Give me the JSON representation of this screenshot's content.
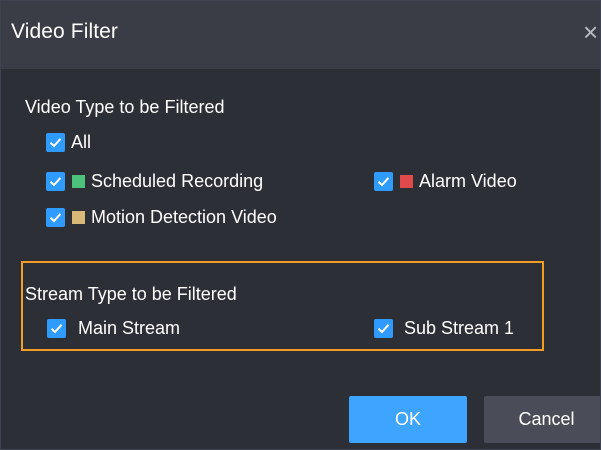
{
  "dialog": {
    "title": "Video Filter",
    "close_icon": "×"
  },
  "video_type": {
    "label": "Video Type to be Filtered",
    "options": [
      {
        "label": "All",
        "checked": true
      },
      {
        "label": "Scheduled Recording",
        "checked": true,
        "swatch": "#4cc27a"
      },
      {
        "label": "Alarm Video",
        "checked": true,
        "swatch": "#e04a4a"
      },
      {
        "label": "Motion Detection Video",
        "checked": true,
        "swatch": "#d9b978"
      }
    ]
  },
  "stream_type": {
    "label": "Stream Type to be Filtered",
    "options": [
      {
        "label": "Main Stream",
        "checked": true
      },
      {
        "label": "Sub Stream 1",
        "checked": true
      }
    ]
  },
  "buttons": {
    "ok_label": "OK",
    "cancel_label": "Cancel"
  },
  "colors": {
    "checkbox_accent": "#2f9bff",
    "highlight_border": "#f39c26",
    "ok_button": "#3da4ff",
    "dialog_background": "#2d2f36",
    "titlebar_background": "#3a3d45"
  },
  "icons": {
    "checkbox": "check-icon",
    "close": "close-icon"
  }
}
